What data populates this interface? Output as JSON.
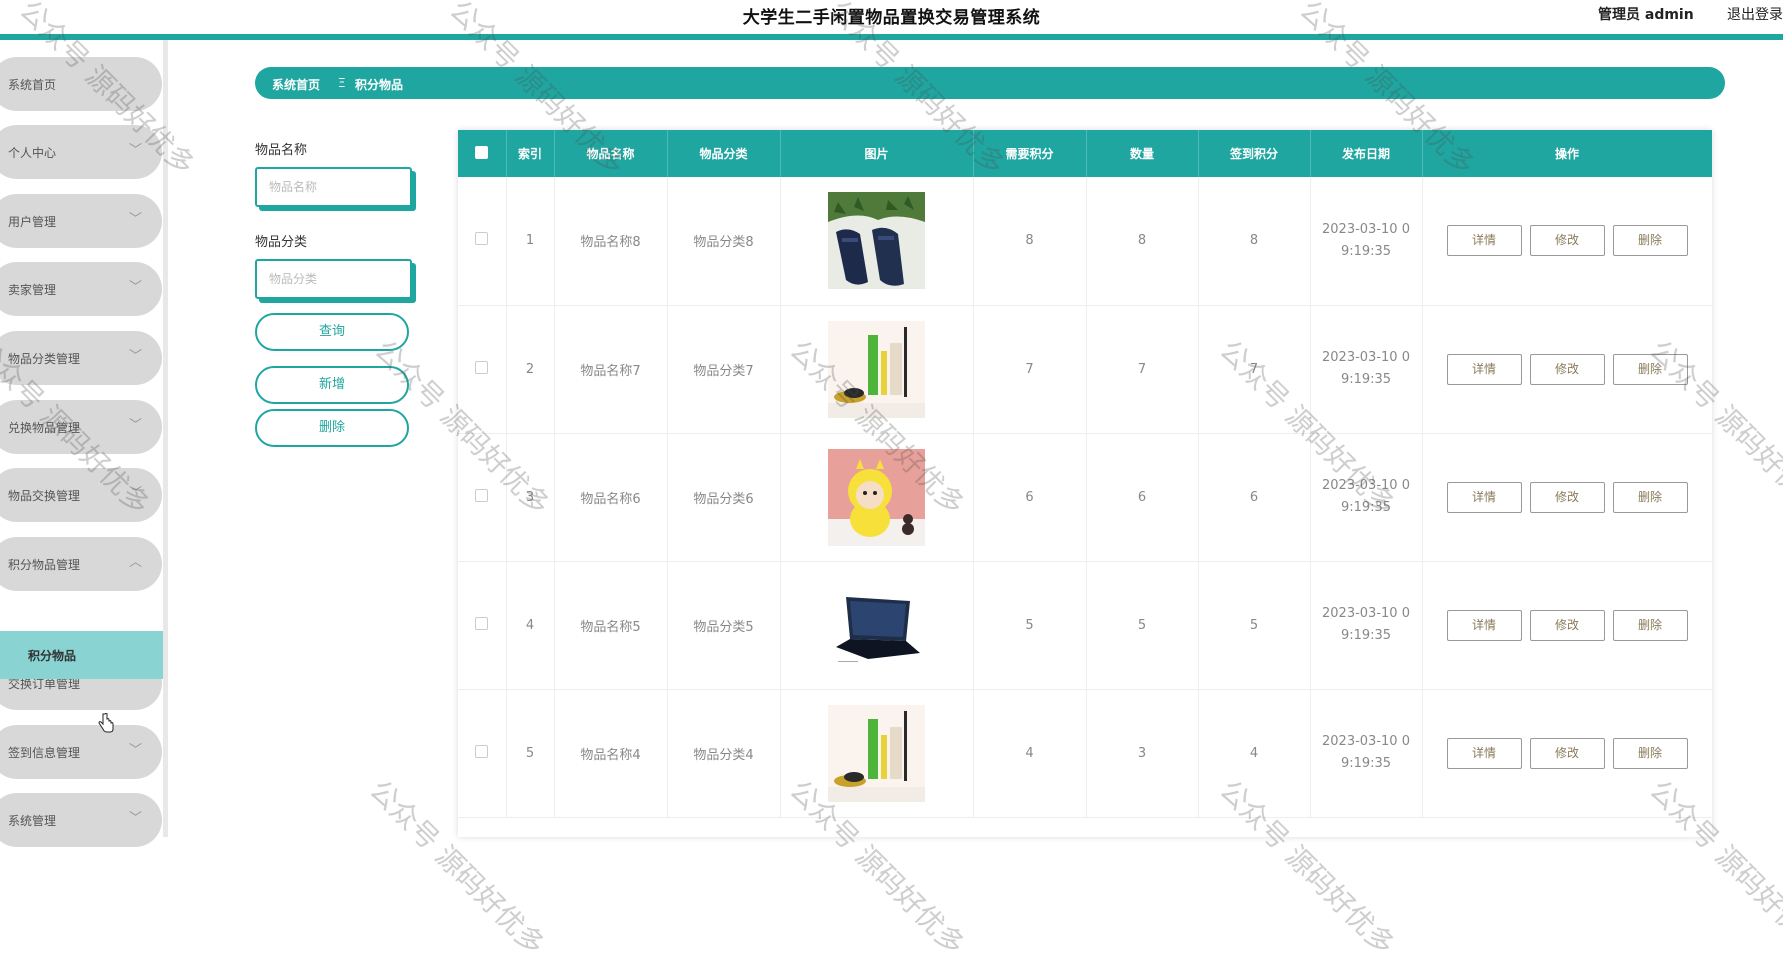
{
  "app": {
    "title": "大学生二手闲置物品置换交易管理系统",
    "admin": "管理员 admin",
    "logout": "退出登录"
  },
  "sidebar": {
    "items": [
      {
        "label": "系统首页",
        "chevron": ""
      },
      {
        "label": "个人中心",
        "chevron": "﹀"
      },
      {
        "label": "用户管理",
        "chevron": "﹀"
      },
      {
        "label": "卖家管理",
        "chevron": "﹀"
      },
      {
        "label": "物品分类管理",
        "chevron": "﹀"
      },
      {
        "label": "兑换物品管理",
        "chevron": "﹀"
      },
      {
        "label": "物品交换管理",
        "chevron": "﹀"
      },
      {
        "label": "积分物品管理",
        "chevron": "︿"
      },
      {
        "label": "交换订单管理",
        "chevron": "﹀"
      },
      {
        "label": "签到信息管理",
        "chevron": "﹀"
      },
      {
        "label": "系统管理",
        "chevron": "﹀"
      }
    ],
    "active_sub": "积分物品"
  },
  "breadcrumb": {
    "home": "系统首页",
    "sep": "Ξ",
    "current": "积分物品"
  },
  "search": {
    "name_label": "物品名称",
    "name_placeholder": "物品名称",
    "category_label": "物品分类",
    "category_placeholder": "物品分类",
    "query_btn": "查询",
    "add_btn": "新增",
    "delete_btn": "删除"
  },
  "table": {
    "headers": [
      "索引",
      "物品名称",
      "物品分类",
      "图片",
      "需要积分",
      "数量",
      "签到积分",
      "发布日期",
      "操作"
    ],
    "actions": {
      "detail": "详情",
      "edit": "修改",
      "delete": "删除"
    },
    "rows": [
      {
        "index": "1",
        "name": "物品名称8",
        "category": "物品分类8",
        "image": "shoes",
        "points": "8",
        "qty": "8",
        "sign": "8",
        "date1": "2023-03-10 0",
        "date2": "9:19:35"
      },
      {
        "index": "2",
        "name": "物品名称7",
        "category": "物品分类7",
        "image": "cosmetics",
        "points": "7",
        "qty": "7",
        "sign": "7",
        "date1": "2023-03-10 0",
        "date2": "9:19:35"
      },
      {
        "index": "3",
        "name": "物品名称6",
        "category": "物品分类6",
        "image": "tiger-plush",
        "points": "6",
        "qty": "6",
        "sign": "6",
        "date1": "2023-03-10 0",
        "date2": "9:19:35"
      },
      {
        "index": "4",
        "name": "物品名称5",
        "category": "物品分类5",
        "image": "laptop",
        "points": "5",
        "qty": "5",
        "sign": "5",
        "date1": "2023-03-10 0",
        "date2": "9:19:35"
      },
      {
        "index": "5",
        "name": "物品名称4",
        "category": "物品分类4",
        "image": "cosmetics",
        "points": "4",
        "qty": "3",
        "sign": "4",
        "date1": "2023-03-10 0",
        "date2": "9:19:35"
      }
    ]
  },
  "watermark": "公众号 源码好优多",
  "colors": {
    "primary": "#1fa6a0",
    "submenu": "#89d3d3",
    "sidebar_item": "#d8d8d8"
  }
}
